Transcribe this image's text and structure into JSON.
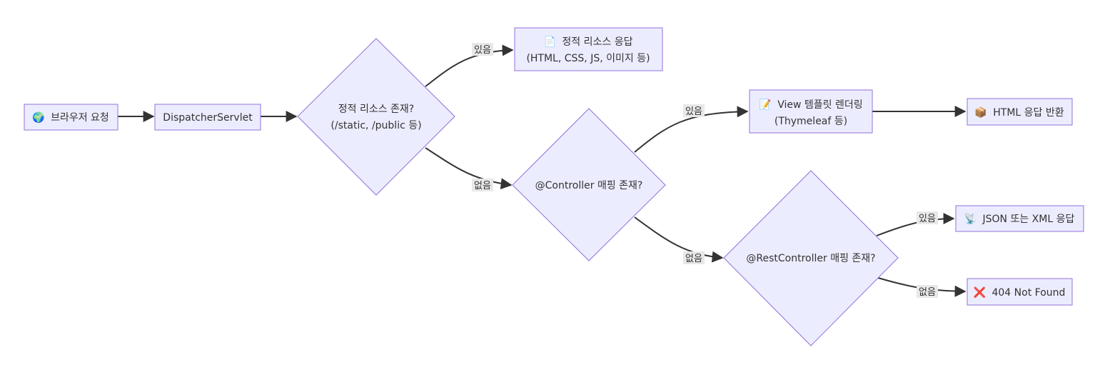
{
  "nodes": {
    "browser": {
      "icon": "🌍",
      "label": "브라우저 요청"
    },
    "dispatcher": {
      "label": "DispatcherServlet"
    },
    "static_check": {
      "line1": "정적 리소스 존재?",
      "line2": "(/static, /public 등)"
    },
    "static_resp": {
      "icon": "📄",
      "line1": "정적 리소스 응답",
      "line2": "(HTML, CSS, JS, 이미지 등)"
    },
    "controller_check": {
      "label": "@Controller 매핑 존재?"
    },
    "view_render": {
      "icon": "📝",
      "line1": "View 템플릿 렌더링",
      "line2": "(Thymeleaf 등)"
    },
    "html_return": {
      "icon": "📦",
      "label": "HTML 응답 반환"
    },
    "rest_check": {
      "label": "@RestController 매핑 존재?"
    },
    "json_resp": {
      "icon": "📡",
      "label": "JSON 또는 XML 응답"
    },
    "not_found": {
      "icon": "❌",
      "label": "404 Not Found"
    }
  },
  "edge_labels": {
    "yes": "있음",
    "no": "없음"
  },
  "colors": {
    "node_fill": "#ececff",
    "node_stroke": "#9370db",
    "edge": "#333333",
    "label_bg": "#e8e8e8"
  }
}
